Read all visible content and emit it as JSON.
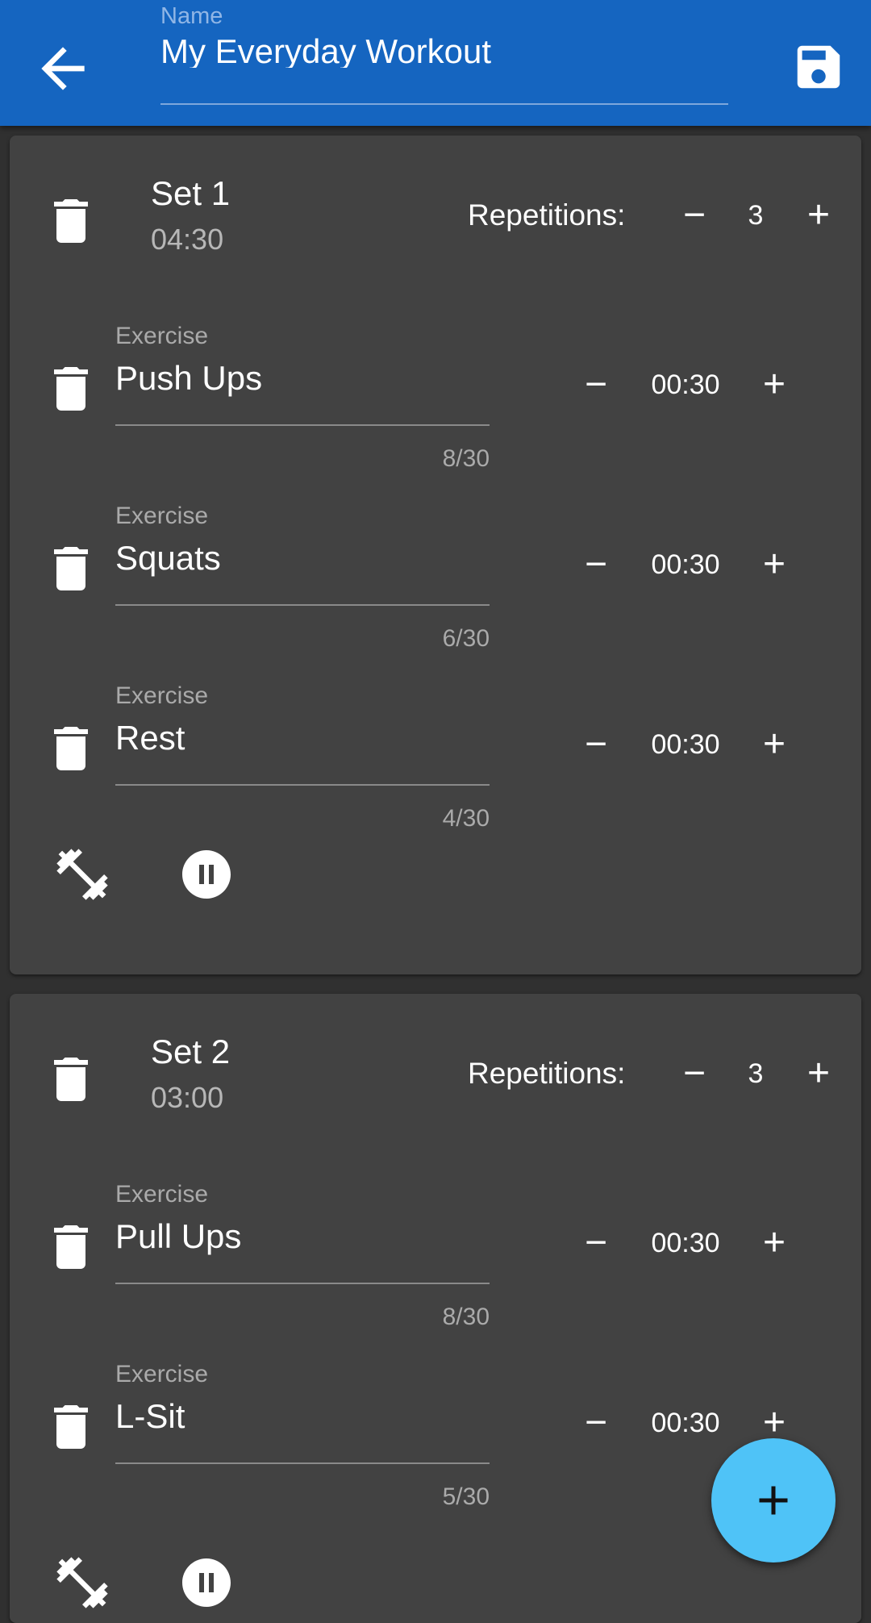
{
  "appbar": {
    "back_icon": "arrow-left-icon",
    "name_label": "Name",
    "name_value": "My Everyday Workout",
    "save_icon": "floppy-disk-icon"
  },
  "sets": [
    {
      "title": "Set 1",
      "duration": "04:30",
      "repetitions_label": "Repetitions:",
      "repetitions": "3",
      "exercises": [
        {
          "label": "Exercise",
          "name": "Push Ups",
          "counter": "8/30",
          "time": "00:30"
        },
        {
          "label": "Exercise",
          "name": "Squats",
          "counter": "6/30",
          "time": "00:30"
        },
        {
          "label": "Exercise",
          "name": "Rest",
          "counter": "4/30",
          "time": "00:30"
        }
      ]
    },
    {
      "title": "Set 2",
      "duration": "03:00",
      "repetitions_label": "Repetitions:",
      "repetitions": "3",
      "exercises": [
        {
          "label": "Exercise",
          "name": "Pull Ups",
          "counter": "8/30",
          "time": "00:30"
        },
        {
          "label": "Exercise",
          "name": "L-Sit",
          "counter": "5/30",
          "time": "00:30"
        }
      ]
    }
  ],
  "controls": {
    "minus": "−",
    "plus": "+"
  },
  "icons": {
    "delete": "trash-icon",
    "add_exercise": "dumbbell-icon",
    "add_rest": "pause-circle-icon",
    "fab": "plus-icon"
  },
  "colors": {
    "primary": "#1565c0",
    "background": "#303030",
    "card": "#424242",
    "fab": "#4fc3f7"
  }
}
